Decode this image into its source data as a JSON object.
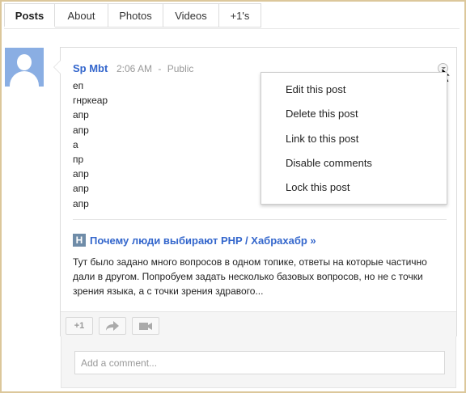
{
  "tabs": [
    {
      "label": "Posts",
      "active": true
    },
    {
      "label": "About"
    },
    {
      "label": "Photos"
    },
    {
      "label": "Videos"
    },
    {
      "label": "+1's"
    }
  ],
  "post": {
    "author": "Sp Mbt",
    "time": "2:06 AM",
    "separator": "-",
    "visibility": "Public",
    "lines": [
      "еп",
      "гнркеар",
      "апр",
      "апр",
      "а",
      "пр",
      "апр",
      "апр",
      "апр"
    ],
    "link_icon_letter": "H",
    "link_title": "Почему люди выбирают PHP / Хабрахабр »",
    "snippet": "Тут было задано много вопросов в одном топике, ответы на которые частично дали в другом. Попробуем задать несколько базовых вопросов, но не с точки зрения языка, а с точки зрения здравого..."
  },
  "actions": {
    "plus_one_label": "+1"
  },
  "comment": {
    "placeholder": "Add a comment..."
  },
  "menu": {
    "items": [
      "Edit this post",
      "Delete this post",
      "Link to this post",
      "Disable comments",
      "Lock this post"
    ]
  },
  "colors": {
    "accent": "#3366cc",
    "avatar": "#8aaee3",
    "frame_border": "#dcc79b"
  }
}
